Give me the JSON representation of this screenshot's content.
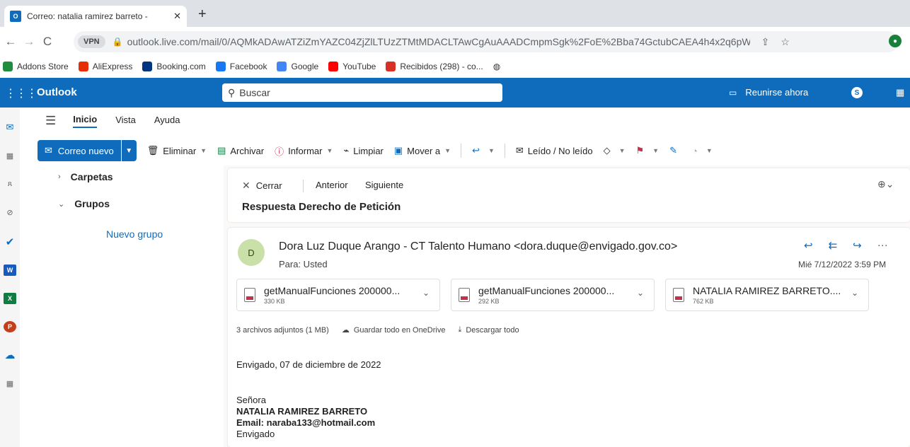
{
  "browser": {
    "tab_title": "Correo: natalia ramirez barreto -",
    "url": "outlook.live.com/mail/0/AQMkADAwATZiZmYAZC04ZjZlLTUzZTMtMDACLTAwCgAuAAADCmpmSgk%2FoE%2Bba74GctubCAEA4h4x2q6pW0...",
    "vpn_label": "VPN",
    "bookmarks": [
      {
        "label": "Addons Store",
        "icon": "addons-icon",
        "color": "#1e8e3e"
      },
      {
        "label": "AliExpress",
        "icon": "aliexpress-icon",
        "color": "#e62e04"
      },
      {
        "label": "Booking.com",
        "icon": "booking-icon",
        "color": "#003580"
      },
      {
        "label": "Facebook",
        "icon": "facebook-icon",
        "color": "#1877f2"
      },
      {
        "label": "Google",
        "icon": "google-icon",
        "color": "#4285f4"
      },
      {
        "label": "YouTube",
        "icon": "youtube-icon",
        "color": "#ff0000"
      },
      {
        "label": "Recibidos (298) - co...",
        "icon": "gmail-icon",
        "color": "#d93025"
      }
    ]
  },
  "outlook": {
    "brand": "Outlook",
    "search_placeholder": "Buscar",
    "meet_now": "Reunirse ahora",
    "accent": "#0f6cbd"
  },
  "ribbon": {
    "tabs": [
      "Inicio",
      "Vista",
      "Ayuda"
    ],
    "new_mail": "Correo nuevo",
    "delete": "Eliminar",
    "archive": "Archivar",
    "report": "Informar",
    "sweep": "Limpiar",
    "move_to": "Mover a",
    "read_unread": "Leído / No leído"
  },
  "folders": {
    "carpetas": "Carpetas",
    "grupos": "Grupos",
    "nuevo_grupo": "Nuevo grupo"
  },
  "reading": {
    "close": "Cerrar",
    "previous": "Anterior",
    "next": "Siguiente",
    "subject": "Respuesta Derecho de Petición"
  },
  "message": {
    "avatar_initial": "D",
    "avatar_color": "#c9e0a9",
    "sender": "Dora Luz Duque Arango - CT Talento Humano <dora.duque@envigado.gov.co>",
    "to": "Para:  Usted",
    "date": "Mié 7/12/2022 3:59 PM",
    "attachments": [
      {
        "name": "getManualFunciones 200000...",
        "size": "330 KB"
      },
      {
        "name": "getManualFunciones 200000...",
        "size": "292 KB"
      },
      {
        "name": "NATALIA RAMIREZ BARRETO....",
        "size": "762 KB"
      }
    ],
    "attachments_summary": "3 archivos adjuntos (1 MB)",
    "save_onedrive": "Guardar todo en OneDrive",
    "download_all": "Descargar todo",
    "body": {
      "place_date": "Envigado, 07 de diciembre de 2022",
      "salutation": "Señora",
      "recipient_name": "NATALIA RAMIREZ BARRETO",
      "email_line": "Email:  naraba133@hotmail.com",
      "city": "Envigado"
    }
  }
}
